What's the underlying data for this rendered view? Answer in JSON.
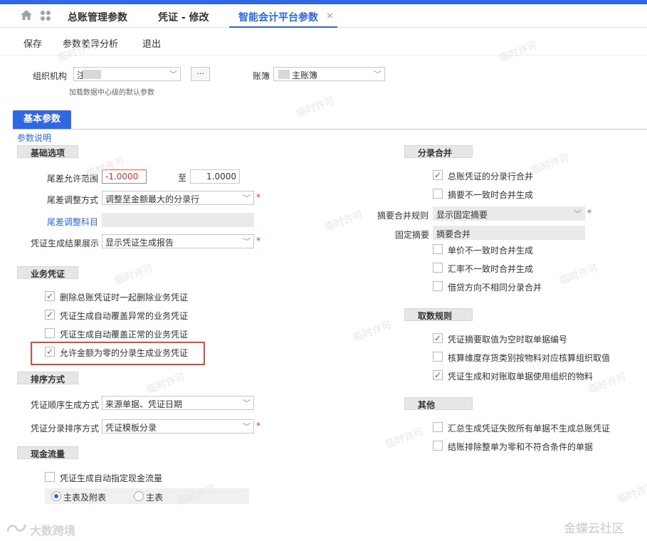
{
  "tabs": [
    "总账管理参数",
    "凭证 - 修改",
    "智能会计平台参数"
  ],
  "tab_close": "×",
  "toolbar": {
    "save": "保存",
    "diff": "参数差异分析",
    "exit": "退出"
  },
  "org": {
    "label": "组织机构",
    "value": "注",
    "hint": "加载数据中心级的默认参数"
  },
  "book": {
    "label": "账簿",
    "value": "主账簿"
  },
  "more_btn": "···",
  "basic_tab": "基本参数",
  "param_desc": "参数说明",
  "basic": {
    "title": "基础选项",
    "tail_range_label": "尾差允许范围",
    "tail_from": "-1.0000",
    "to": "至",
    "tail_to": "1.0000",
    "tail_adjust_label": "尾差调整方式",
    "tail_adjust_value": "调整至金额最大的分录行",
    "tail_subject_label": "尾差调整科目",
    "gen_result_label": "凭证生成结果展示",
    "gen_result_value": "显示凭证生成报告"
  },
  "biz": {
    "title": "业务凭证",
    "items": [
      {
        "label": "删除总账凭证时一起删除业务凭证",
        "checked": true
      },
      {
        "label": "凭证生成自动覆盖异常的业务凭证",
        "checked": true
      },
      {
        "label": "凭证生成自动覆盖正常的业务凭证",
        "checked": false
      },
      {
        "label": "允许金额为零的分录生成业务凭证",
        "checked": true
      }
    ]
  },
  "sort": {
    "title": "排序方式",
    "order_label": "凭证顺序生成方式",
    "order_value": "来源单据、凭证日期",
    "entry_label": "凭证分录排序方式",
    "entry_value": "凭证模板分录"
  },
  "cash": {
    "title": "现金流量",
    "auto_label": "凭证生成自动指定现金流量",
    "radio1": "主表及附表",
    "radio2": "主表"
  },
  "merge": {
    "title": "分录合并",
    "item1": "总账凭证的分录行合并",
    "item2": "摘要不一致时合并生成",
    "rule_label": "摘要合并规则",
    "rule_value": "显示固定摘要",
    "fixed_label": "固定摘要",
    "fixed_value": "摘要合并",
    "item3": "单价不一致时合并生成",
    "item4": "汇率不一致时合并生成",
    "item5": "借贷方向不相同分录合并"
  },
  "fetch": {
    "title": "取数规则",
    "item1": "凭证摘要取值为空时取单据编号",
    "item2": "核算维度存货类别按物料对应核算组织取值",
    "item3": "凭证生成和对账取单据使用组织的物料"
  },
  "other": {
    "title": "其他",
    "item1": "汇总生成凭证失败所有单据不生成总账凭证",
    "item2": "结账排除整单为零和不符合条件的单据"
  },
  "watermark": "临时许可",
  "footer_left": "大数跨境",
  "footer_right": "金蝶云社区",
  "colors": {
    "accent": "#2f68e0",
    "highlight_box": "#e04a3a"
  }
}
